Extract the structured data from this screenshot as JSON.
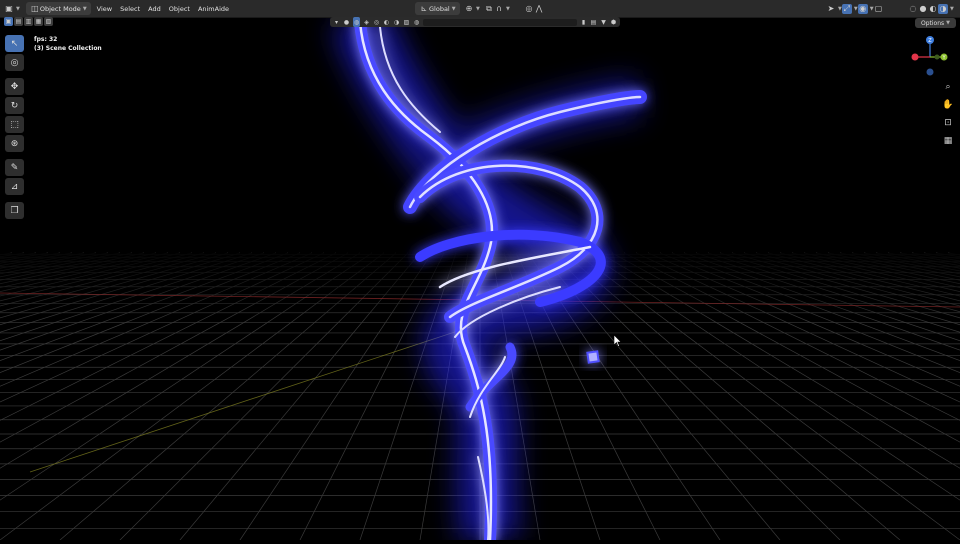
{
  "header": {
    "mode": "Object Mode",
    "menus": [
      "View",
      "Select",
      "Add",
      "Object",
      "AnimAide"
    ],
    "orientation": "Global",
    "options_label": "Options"
  },
  "overlay": {
    "fps": "fps: 32",
    "collection": "(3) Scene Collection"
  },
  "gizmo": {
    "axis_colors": {
      "x": "#e2354a",
      "y": "#8bbf2e",
      "z": "#3f7fe0"
    },
    "axis_labels": {
      "x": "X",
      "y": "Y",
      "z": "Z"
    }
  },
  "toolbar": {
    "tools": [
      "select-box",
      "cursor",
      "move",
      "rotate",
      "scale",
      "transform",
      "annotate",
      "measure",
      "add-cube"
    ],
    "active": "select-box"
  },
  "scene": {
    "background": "#000000",
    "grid_color": "#3a3a3a",
    "glow_color": "#3b3bff",
    "core_color": "#d8d8ff"
  }
}
